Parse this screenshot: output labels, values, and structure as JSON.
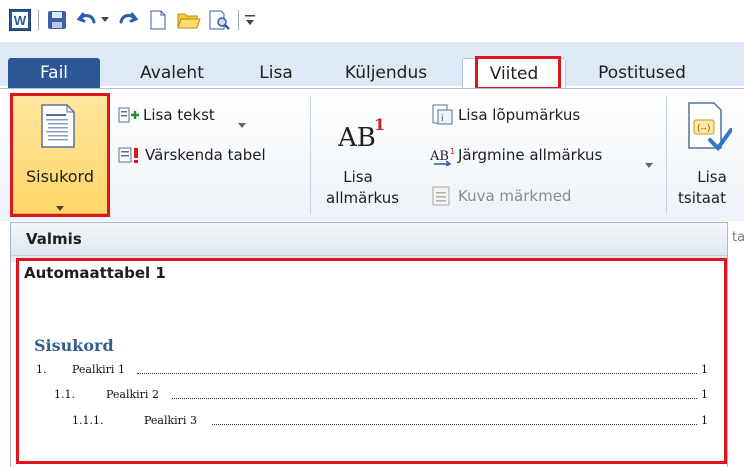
{
  "ribbon_tabs": {
    "file": "Fail",
    "home": "Avaleht",
    "insert": "Lisa",
    "layout": "Küljendus",
    "references": "Viited",
    "mailings": "Postitused"
  },
  "toc_group": {
    "toc_button": "Sisukord",
    "add_text": "Lisa tekst",
    "update_table": "Värskenda tabel"
  },
  "footnotes_group": {
    "insert_footnote_line1": "Lisa",
    "insert_footnote_line2": "allmärkus",
    "insert_endnote": "Lisa lõpumärkus",
    "next_footnote": "Järgmine allmärkus",
    "show_notes": "Kuva märkmed"
  },
  "citations_group": {
    "insert_citation_line1": "Lisa",
    "insert_citation_line2": "tsitaat",
    "group_label_partial": "ta"
  },
  "dropdown": {
    "section_header": "Valmis",
    "gallery_item_title": "Automaattabel 1",
    "preview": {
      "heading": "Sisukord",
      "entries": [
        {
          "number": "1.",
          "text": "Pealkiri 1",
          "page": "1"
        },
        {
          "number": "1.1.",
          "text": "Pealkiri 2",
          "page": "1"
        },
        {
          "number": "1.1.1.",
          "text": "Pealkiri 3",
          "page": "1"
        }
      ]
    }
  },
  "colors": {
    "file_tab": "#2b5797",
    "highlight_red": "#e0141d",
    "heading_blue": "#365f91",
    "active_button": "#ffd667"
  }
}
